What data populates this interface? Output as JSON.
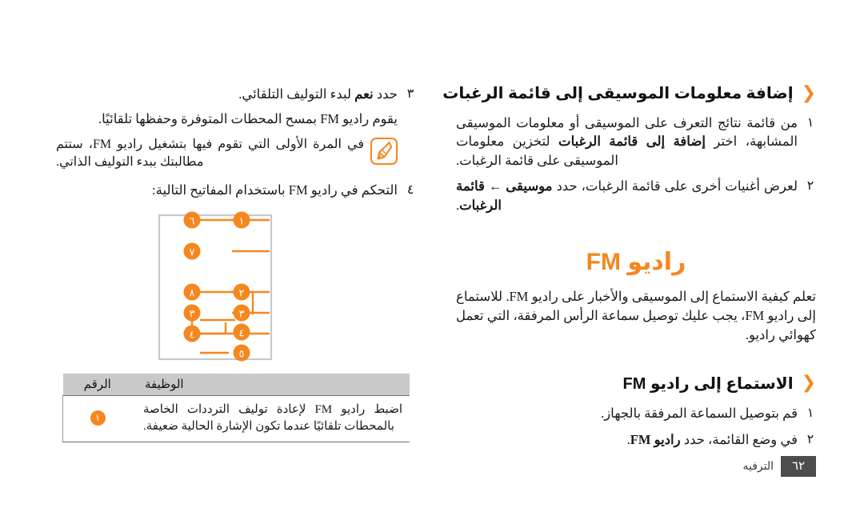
{
  "colors": {
    "accent": "#f5871f",
    "heading_text": "#111111",
    "body_text": "#1a1a1a",
    "table_header_bg": "#c9c9c9",
    "footer_badge_bg": "#4d4d4d",
    "device_outline": "#c8c8c8"
  },
  "right_column": {
    "section_heading": {
      "chevron": "chevron-left-icon",
      "text": "إضافة معلومات الموسيقى إلى قائمة الرغبات"
    },
    "steps": [
      {
        "marker": "١",
        "text_before": "من قائمة نتائج التعرف على الموسيقى أو معلومات الموسيقى المشابهة، اختر ",
        "bold": "إضافة إلى قائمة الرغبات",
        "text_after": " لتخزين معلومات الموسيقى على قائمة الرغبات."
      },
      {
        "marker": "٢",
        "text_before": "لعرض أغنيات أخرى على قائمة الرغبات، حدد ",
        "bold": "موسيقى ← قائمة الرغبات",
        "text_after": "."
      }
    ],
    "main_heading": "راديو FM",
    "intro_paragraph": "تعلم كيفية الاستماع إلى الموسيقى والأخبار على راديو FM. للاستماع إلى راديو FM، يجب عليك توصيل سماعة الرأس المرفقة، التي تعمل كهوائي راديو.",
    "section_heading_2": {
      "chevron": "chevron-left-icon",
      "text": "الاستماع إلى راديو FM"
    },
    "steps_2": [
      {
        "marker": "١",
        "text_before": "قم بتوصيل السماعة المرفقة بالجهاز.",
        "bold": "",
        "text_after": ""
      },
      {
        "marker": "٢",
        "text_before": "في وضع القائمة، حدد ",
        "bold": "راديو FM",
        "text_after": "."
      }
    ]
  },
  "left_column": {
    "steps": [
      {
        "marker": "٣",
        "text_before": "حدد ",
        "bold": "نعم",
        "text_after": " لبدء التوليف التلقائي."
      }
    ],
    "continuation": "يقوم راديو FM بمسح المحطات المتوفرة وحفظها تلقائيًا.",
    "note": {
      "icon": "note-pen-icon",
      "text": "في المرة الأولى التي تقوم فيها بتشغيل راديو FM، ستتم مطالبتك ببدء التوليف الذاتي."
    },
    "step_4": {
      "marker": "٤",
      "text": "التحكم في راديو FM باستخدام المفاتيح التالية:"
    }
  },
  "diagram": {
    "name": "fm-radio-key-diagram",
    "device_label": "phone-outline",
    "callouts_left": [
      "١",
      "٢",
      "٣",
      "٤",
      "٥"
    ],
    "callouts_right": [
      "٦",
      "٧",
      "٨",
      "٣",
      "٤"
    ]
  },
  "table": {
    "headers": {
      "number": "الرقم",
      "function": "الوظيفة"
    },
    "rows": [
      {
        "number": "١",
        "function": "اضبط راديو FM لإعادة توليف الترددات الخاصة بالمحطات تلقائيًا عندما تكون الإشارة الحالية ضعيفة."
      }
    ]
  },
  "footer": {
    "label": "الترفيه",
    "page": "٦٢"
  }
}
